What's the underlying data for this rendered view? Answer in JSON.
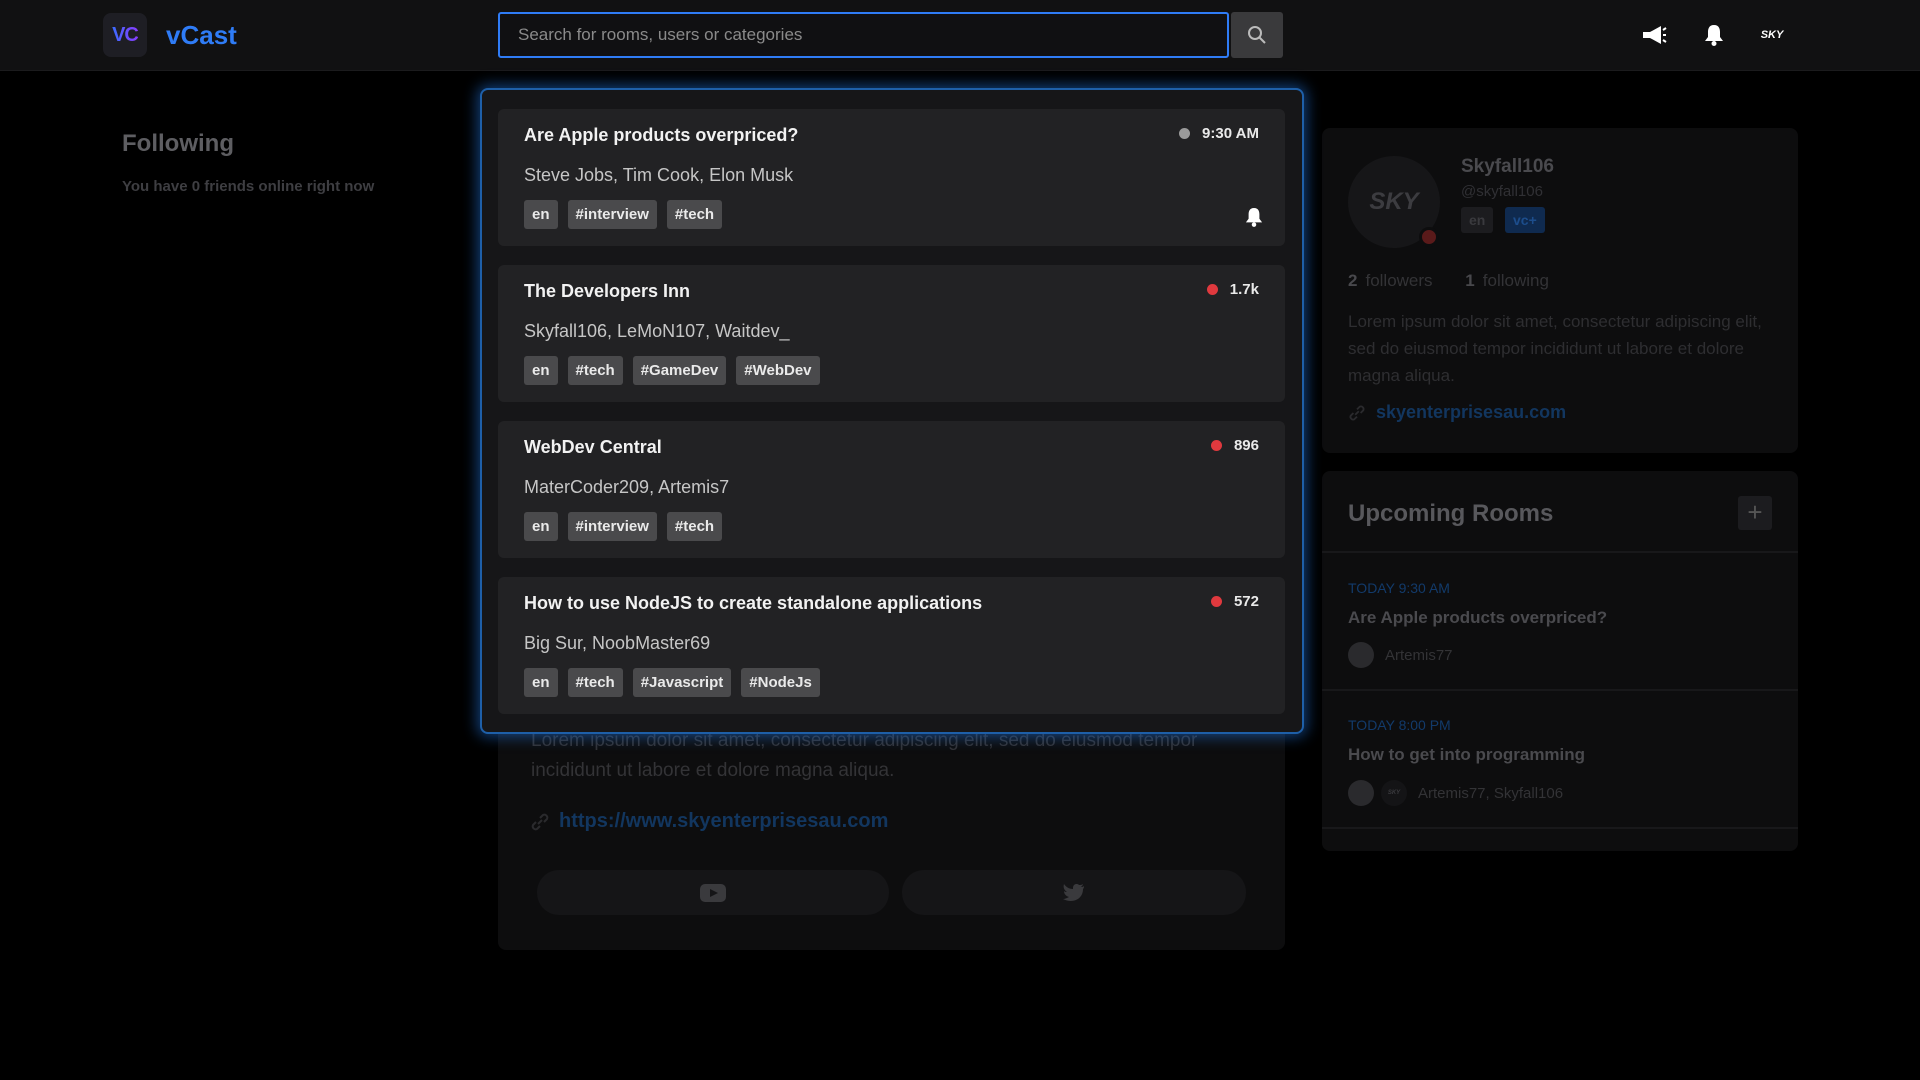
{
  "header": {
    "logo_text": "VC",
    "brand": "vCast",
    "search_placeholder": "Search for rooms, users or categories",
    "avatar_text": "SKY"
  },
  "following": {
    "title": "Following",
    "subtitle": "You have 0 friends online right now"
  },
  "background_room": {
    "description": "Lorem ipsum dolor sit amet, consectetur adipiscing elit, sed do eiusmod tempor incididunt ut labore et dolore magna aliqua.",
    "link": "https://www.skyenterprisesau.com"
  },
  "profile": {
    "avatar_text": "SKY",
    "name": "Skyfall106",
    "handle": "@skyfall106",
    "lang": "en",
    "badge": "vc+",
    "followers_count": "2",
    "followers_label": "followers",
    "following_count": "1",
    "following_label": "following",
    "bio": "Lorem ipsum dolor sit amet, consectetur adipiscing elit, sed do eiusmod tempor incididunt ut labore et dolore magna aliqua.",
    "website": "skyenterprisesau.com"
  },
  "upcoming": {
    "title": "Upcoming Rooms",
    "items": [
      {
        "time": "TODAY 9:30 AM",
        "name": "Are Apple products overpriced?",
        "users": "Artemis77"
      },
      {
        "time": "TODAY 8:00 PM",
        "name": "How to get into programming",
        "users": "Artemis77, Skyfall106",
        "second_avatar_text": "SKY"
      }
    ]
  },
  "search_results": [
    {
      "title": "Are Apple products overpriced?",
      "users": "Steve Jobs, Tim Cook, Elon Musk",
      "meta": "9:30 AM",
      "status": "scheduled",
      "tags": [
        "en",
        "#interview",
        "#tech"
      ]
    },
    {
      "title": "The Developers Inn",
      "users": "Skyfall106, LeMoN107, Waitdev_",
      "meta": "1.7k",
      "status": "live",
      "tags": [
        "en",
        "#tech",
        "#GameDev",
        "#WebDev"
      ]
    },
    {
      "title": "WebDev Central",
      "users": "MaterCoder209, Artemis7",
      "meta": "896",
      "status": "live",
      "tags": [
        "en",
        "#interview",
        "#tech"
      ]
    },
    {
      "title": "How to use NodeJS to create standalone applications",
      "users": "Big Sur, NoobMaster69",
      "meta": "572",
      "status": "live",
      "tags": [
        "en",
        "#tech",
        "#Javascript",
        "#NodeJs"
      ]
    }
  ],
  "colors": {
    "accent": "#2f7cf6",
    "live": "#e0393e",
    "scheduled": "#9a9a9a"
  }
}
